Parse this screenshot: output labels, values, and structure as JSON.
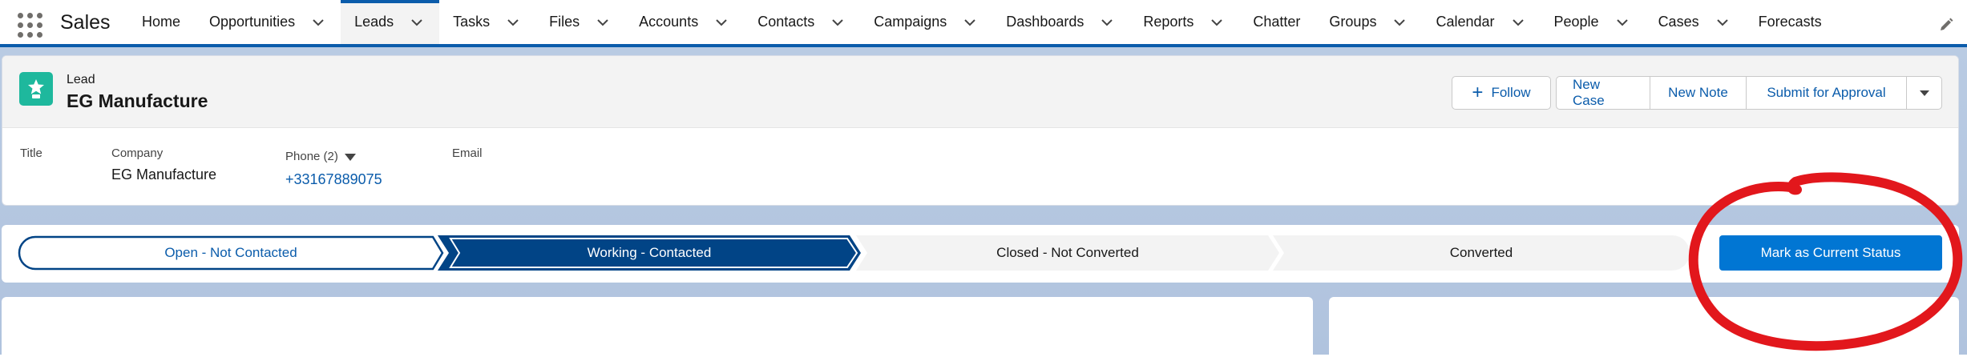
{
  "app": {
    "name": "Sales"
  },
  "nav": {
    "items": [
      {
        "label": "Home",
        "chevron": false,
        "active": false
      },
      {
        "label": "Opportunities",
        "chevron": true,
        "active": false
      },
      {
        "label": "Leads",
        "chevron": true,
        "active": true
      },
      {
        "label": "Tasks",
        "chevron": true,
        "active": false
      },
      {
        "label": "Files",
        "chevron": true,
        "active": false
      },
      {
        "label": "Accounts",
        "chevron": true,
        "active": false
      },
      {
        "label": "Contacts",
        "chevron": true,
        "active": false
      },
      {
        "label": "Campaigns",
        "chevron": true,
        "active": false
      },
      {
        "label": "Dashboards",
        "chevron": true,
        "active": false
      },
      {
        "label": "Reports",
        "chevron": true,
        "active": false
      },
      {
        "label": "Chatter",
        "chevron": false,
        "active": false
      },
      {
        "label": "Groups",
        "chevron": true,
        "active": false
      },
      {
        "label": "Calendar",
        "chevron": true,
        "active": false
      },
      {
        "label": "People",
        "chevron": true,
        "active": false
      },
      {
        "label": "Cases",
        "chevron": true,
        "active": false
      },
      {
        "label": "Forecasts",
        "chevron": false,
        "active": false
      }
    ]
  },
  "record": {
    "object_type": "Lead",
    "name": "EG Manufacture",
    "actions": {
      "follow": "Follow",
      "new_case": "New Case",
      "new_note": "New Note",
      "submit": "Submit for Approval"
    },
    "fields": {
      "title_label": "Title",
      "company_label": "Company",
      "company_value": "EG Manufacture",
      "phone_label": "Phone (2)",
      "phone_value": "+33167889075",
      "email_label": "Email"
    }
  },
  "path": {
    "stages": [
      {
        "label": "Open - Not Contacted",
        "state": "complete"
      },
      {
        "label": "Working - Contacted",
        "state": "current"
      },
      {
        "label": "Closed - Not Converted",
        "state": "incomplete"
      },
      {
        "label": "Converted",
        "state": "incomplete"
      }
    ],
    "mark_button": "Mark as Current Status"
  },
  "colors": {
    "brand": "#0176d3",
    "nav_active": "#0b5cab",
    "path_current": "#014486",
    "lead_icon": "#1eb89d",
    "annotation": "#e2171c"
  }
}
